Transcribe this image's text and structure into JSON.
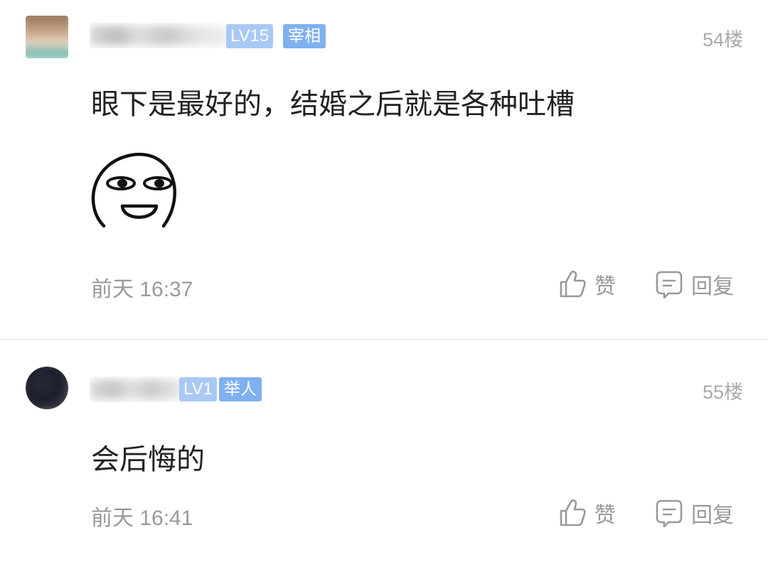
{
  "posts": [
    {
      "level_badge": "LV15",
      "title_badge": "宰相",
      "floor": "54楼",
      "text": "眼下是最好的，结婚之后就是各种吐槽",
      "sticker_icon": "smirk-face-sticker",
      "time": "前天 16:37",
      "like_label": "赞",
      "reply_label": "回复"
    },
    {
      "level_badge": "LV1",
      "title_badge": "举人",
      "floor": "55楼",
      "text": "会后悔的",
      "time": "前天 16:41",
      "like_label": "赞",
      "reply_label": "回复"
    }
  ],
  "colors": {
    "level_badge_bg": "#a9c9f5",
    "title_badge_bg": "#7fb0ef",
    "secondary_text": "#999999",
    "primary_text": "#222222"
  }
}
